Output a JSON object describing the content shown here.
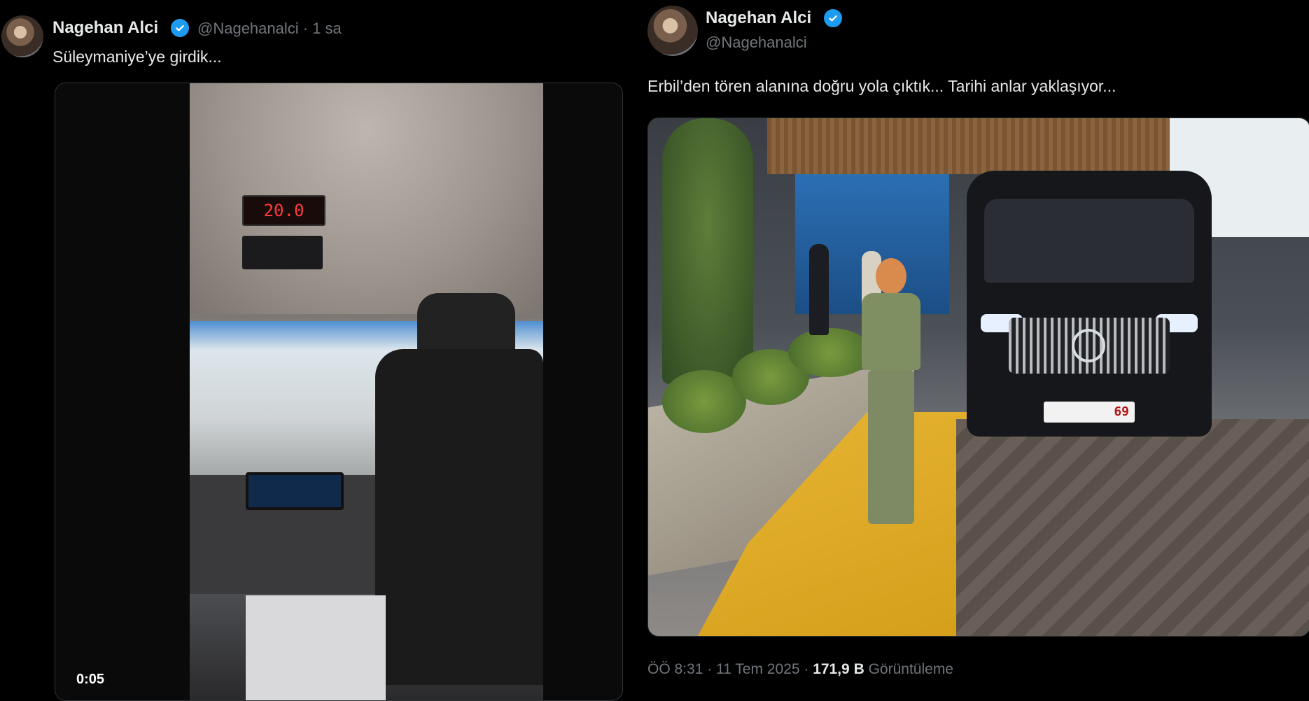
{
  "left_tweet": {
    "name": "Nagehan Alci",
    "handle": "@Nagehanalci · 1 sa",
    "text": "Süleymaniye’ye girdik...",
    "video_time": "0:05",
    "media_red_display": "20.0"
  },
  "right_tweet": {
    "name": "Nagehan Alci",
    "handle": "@Nagehanalci",
    "text": "Erbil’den tören alanına doğru yola çıktık... Tarihi anlar yaklaşıyor...",
    "plate_number": "69",
    "meta_time": "ÖÖ 8:31 · 11 Tem 2025 ·",
    "views_count": "171,9 B",
    "views_label": "Görüntüleme"
  },
  "icons": {
    "verified": "verified-badge-icon"
  },
  "colors": {
    "background": "#000000",
    "primary_text": "#e7e9ea",
    "secondary_text": "#71767b",
    "verified_blue": "#1d9bf0"
  }
}
